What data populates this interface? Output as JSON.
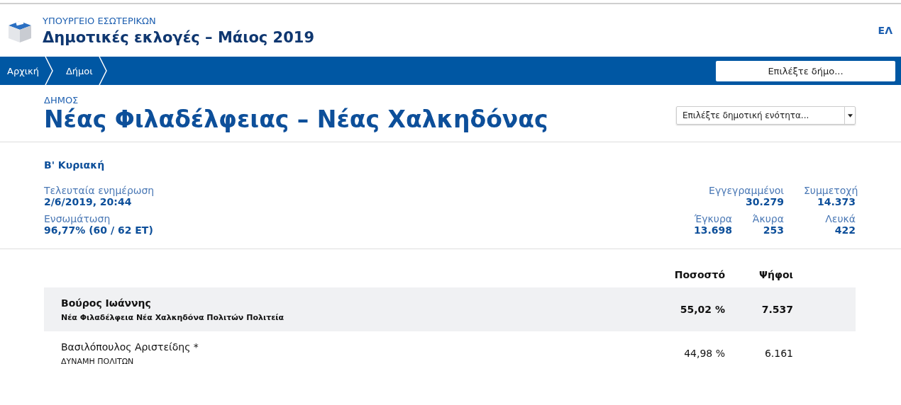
{
  "header": {
    "ministry": "ΥΠΟΥΡΓΕΙΟ ΕΣΩΤΕΡΙΚΩΝ",
    "title": "Δημοτικές εκλογές – Μάιος 2019",
    "language": "ΕΛ"
  },
  "breadcrumb": [
    {
      "label": "Αρχική"
    },
    {
      "label": "Δήμοι"
    }
  ],
  "municipality_picker": {
    "placeholder": "Επιλέξτε δήμο..."
  },
  "municipality": {
    "kicker": "ΔΗΜΟΣ",
    "name": "Νέας Φιλαδέλφειας – Νέας Χαλκηδόνας",
    "unit_select": "Επιλέξτε δημοτική ενότητα..."
  },
  "round": "Β' Κυριακή",
  "info": [
    {
      "label": "Τελευταία ενημέρωση",
      "value": "2/6/2019, 20:44"
    },
    {
      "label": "Ενσωμάτωση",
      "value": "96,77% (60 / 62 ΕΤ)"
    }
  ],
  "stats": [
    [
      {
        "label": "Εγγεγραμμένοι",
        "value": "30.279",
        "wide": true
      },
      {
        "label": "Συμμετοχή",
        "value": "14.373",
        "wide": false
      }
    ],
    [
      {
        "label": "Έγκυρα",
        "value": "13.698",
        "wide": false
      },
      {
        "label": "Άκυρα",
        "value": "253",
        "wide": false
      },
      {
        "label": "Λευκά",
        "value": "422",
        "wide": false
      }
    ]
  ],
  "results": {
    "columns": [
      "Ποσοστό",
      "Ψήφοι"
    ],
    "rows": [
      {
        "candidate": "Βούρος Ιωάννης",
        "party": "Νέα Φιλαδέλφεια Νέα Χαλκηδόνα Πολιτών Πολιτεία",
        "percent": "55,02 %",
        "votes": "7.537",
        "winner": true
      },
      {
        "candidate": "Βασιλόπουλος Αριστείδης *",
        "party": "ΔΥΝΑΜΗ ΠΟΛΙΤΩΝ",
        "percent": "44,98 %",
        "votes": "6.161",
        "winner": false
      }
    ]
  }
}
